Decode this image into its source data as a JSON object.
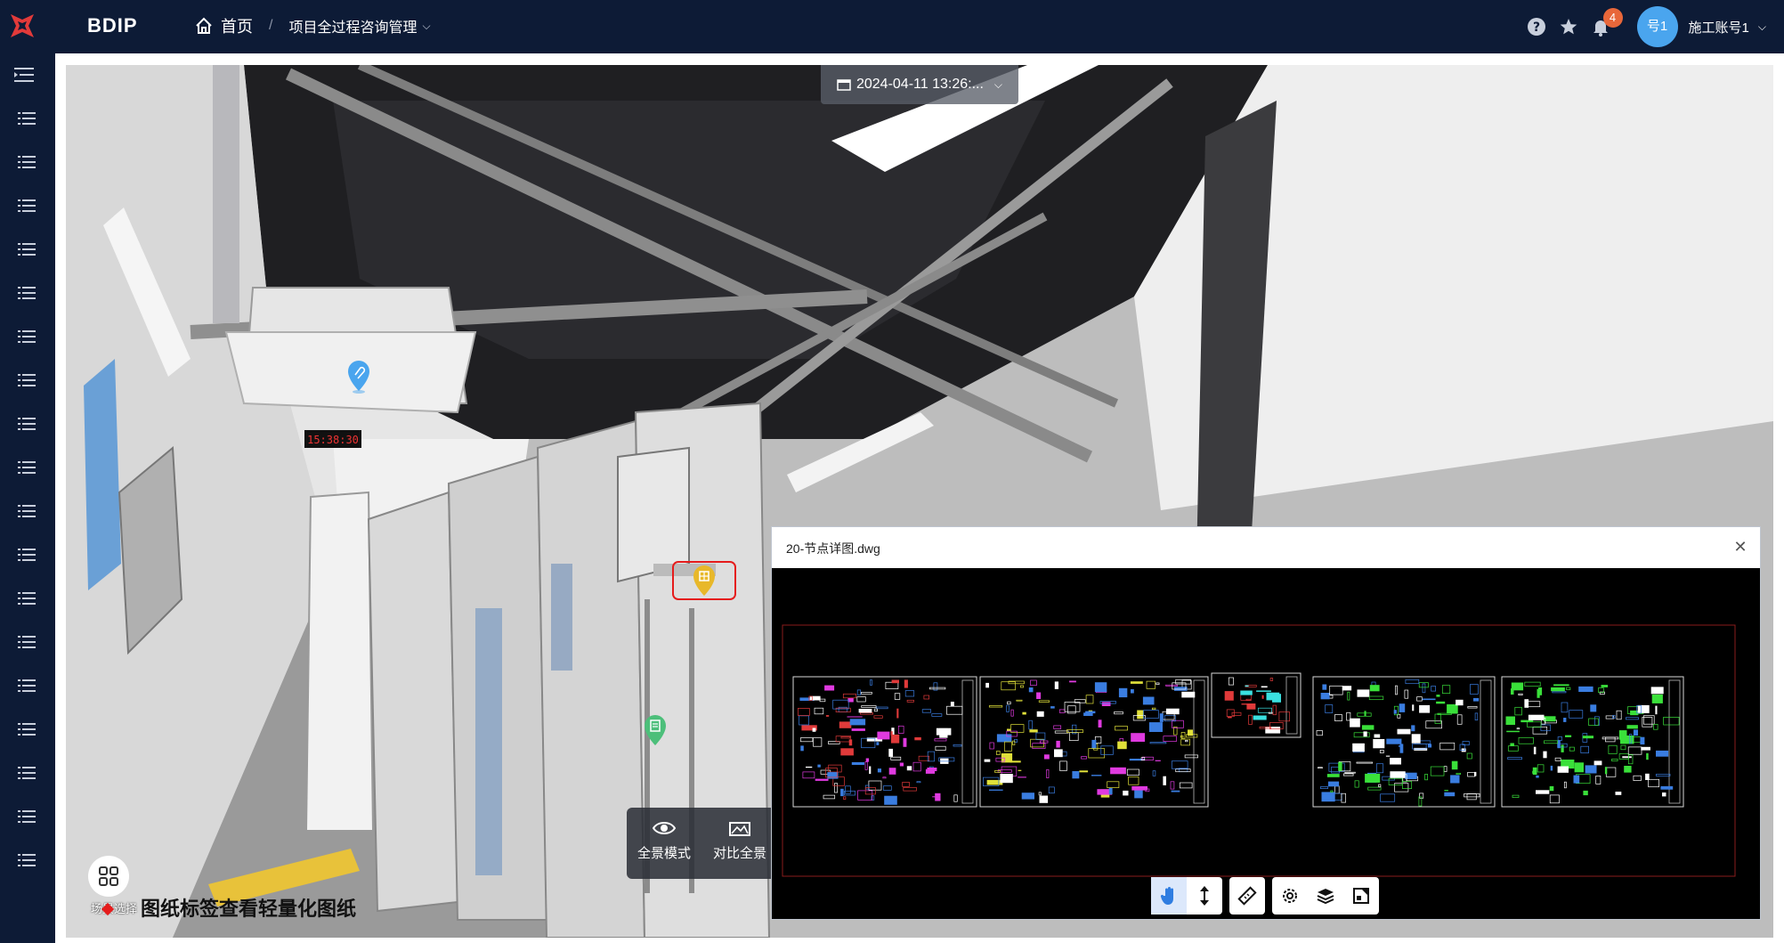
{
  "app": {
    "brand": "BDIP"
  },
  "breadcrumb": {
    "home": "首页",
    "project": "项目全过程咨询管理"
  },
  "header": {
    "notifications_count": "4",
    "avatar_text": "号1",
    "username": "施工账号1"
  },
  "viewer": {
    "date_selector": "2024-04-11 13:26:...",
    "modes": [
      {
        "label": "全景模式"
      },
      {
        "label": "对比全景"
      }
    ],
    "scene_select_label": "场景选择",
    "caption": "图纸标签查看轻量化图纸",
    "clock_display": "15:38:30"
  },
  "drawing_panel": {
    "title": "20-节点详图.dwg",
    "toolbar_icons": [
      "hand-pan-icon",
      "vertical-move-icon",
      "ruler-icon",
      "settings-icon",
      "layers-icon",
      "view-switch-icon"
    ]
  },
  "colors": {
    "nav_bg": "#0d1b36",
    "avatar": "#4aa5ee",
    "badge": "#e8673a",
    "pin_blue": "#4aa5ee",
    "pin_yellow": "#e8b82a",
    "pin_green": "#4cbf7a",
    "highlight": "#e51c1c"
  }
}
